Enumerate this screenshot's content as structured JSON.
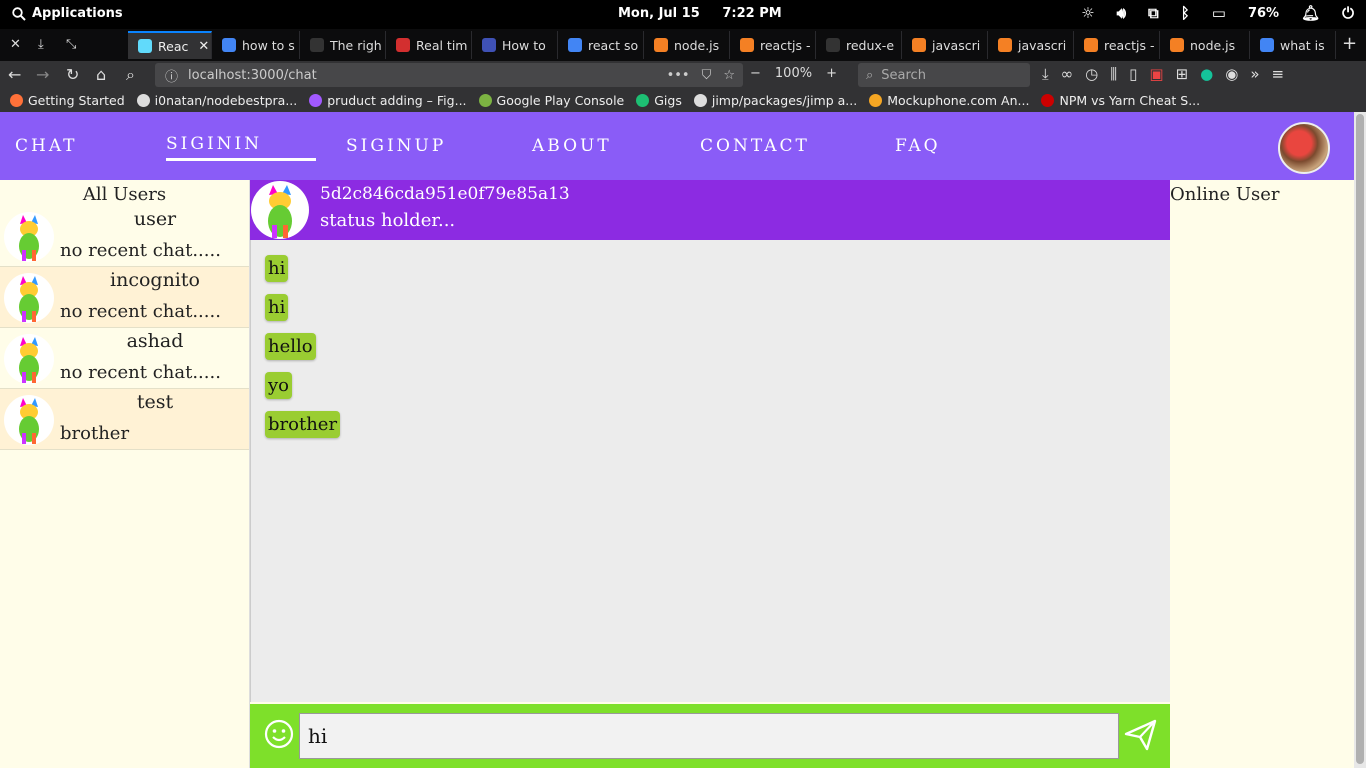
{
  "os": {
    "apps_label": "Applications",
    "clock": "Mon, Jul 15     7:22 PM",
    "battery": "76%"
  },
  "browser": {
    "tabs": [
      {
        "label": "Reac",
        "active": true,
        "color": "#61dafb"
      },
      {
        "label": "how to s",
        "color": "#4285f4"
      },
      {
        "label": "The righ",
        "color": "#333333"
      },
      {
        "label": "Real tim",
        "color": "#d32f2f"
      },
      {
        "label": "How to",
        "color": "#3f51b5"
      },
      {
        "label": "react so",
        "color": "#4285f4"
      },
      {
        "label": "node.js",
        "color": "#f48024"
      },
      {
        "label": "reactjs -",
        "color": "#f48024"
      },
      {
        "label": "redux-e",
        "color": "#333333"
      },
      {
        "label": "javascri",
        "color": "#f48024"
      },
      {
        "label": "javascri",
        "color": "#f48024"
      },
      {
        "label": "reactjs -",
        "color": "#f48024"
      },
      {
        "label": "node.js",
        "color": "#f48024"
      },
      {
        "label": "what is",
        "color": "#4285f4"
      }
    ],
    "url": "localhost:3000/chat",
    "zoom": "100%",
    "search_placeholder": "Search",
    "bookmarks": [
      {
        "label": "Getting Started",
        "color": "#ff7139"
      },
      {
        "label": "i0natan/nodebestpra...",
        "color": "#dddddd"
      },
      {
        "label": "pruduct adding – Fig...",
        "color": "#a259ff"
      },
      {
        "label": "Google Play Console",
        "color": "#7cb342"
      },
      {
        "label": "Gigs",
        "color": "#1dbf73"
      },
      {
        "label": "jimp/packages/jimp a...",
        "color": "#dddddd"
      },
      {
        "label": "Mockuphone.com An...",
        "color": "#f5a623"
      },
      {
        "label": "NPM vs Yarn Cheat S...",
        "color": "#cc0000"
      }
    ]
  },
  "app": {
    "nav": {
      "chat": "CHAT",
      "signin": "SIGININ",
      "signup": "SIGINUP",
      "about": "ABOUT",
      "contact": "CONTACT",
      "faq": "FAQ"
    },
    "users_title": "All Users",
    "users": [
      {
        "name": "user",
        "last": "no recent chat....."
      },
      {
        "name": "incognito",
        "last": "no recent chat....."
      },
      {
        "name": "ashad",
        "last": "no recent chat....."
      },
      {
        "name": "test",
        "last": "brother"
      }
    ],
    "chat_header": {
      "id": "5d2c846cda951e0f79e85a13",
      "status": "status holder..."
    },
    "messages": [
      "hi",
      "hi",
      "hello",
      "yo",
      "brother"
    ],
    "composer_value": "hi",
    "online_title": "Online User",
    "colors": {
      "nav": "#8a5cf7",
      "chat_header": "#8c2be2",
      "bubble": "#9acd32",
      "composer": "#7ee02a",
      "page_bg": "#fffde9"
    }
  }
}
